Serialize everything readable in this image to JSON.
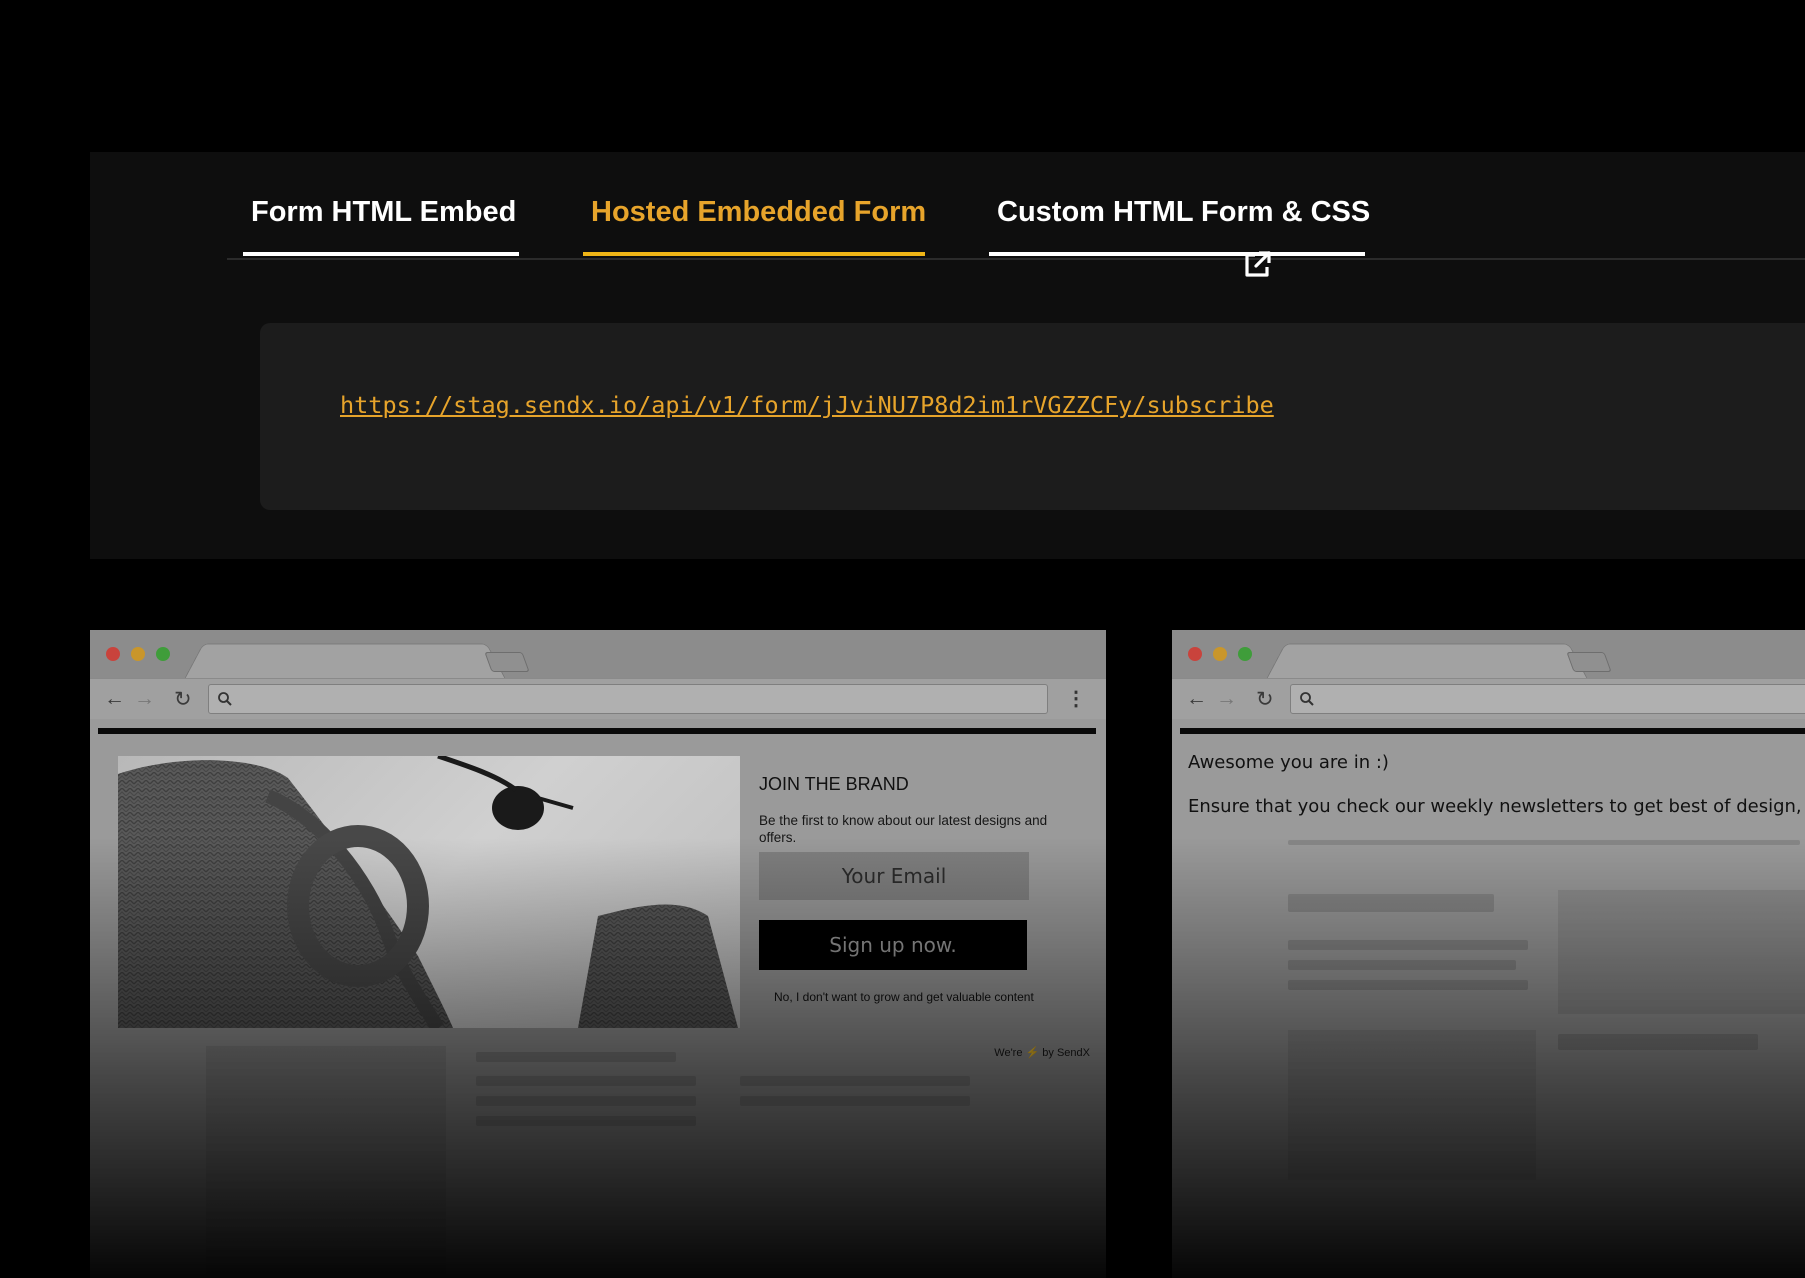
{
  "tabs": [
    {
      "label": "Form HTML Embed",
      "active": false
    },
    {
      "label": "Hosted Embedded Form",
      "active": true
    },
    {
      "label": "Custom HTML Form & CSS",
      "active": false
    }
  ],
  "hosted_url": "https://stag.sendx.io/api/v1/form/jJviNU7P8d2im1rVGZZCFy/subscribe",
  "colors": {
    "accent": "#f0b517",
    "accent_text": "#e7a42b",
    "panel": "#0e0e0e",
    "url_box": "#1c1c1c"
  },
  "icons": {
    "external_link": "external-link-icon",
    "search": "search-icon",
    "back": "back-arrow-icon",
    "forward": "forward-arrow-icon",
    "reload": "reload-icon",
    "menu": "kebab-menu-icon"
  },
  "form_preview": {
    "title": "JOIN THE BRAND",
    "description": "Be the first to know about our latest designs and offers.",
    "email_placeholder": "Your Email",
    "submit_label": "Sign up now.",
    "decline_link": "No, I don't want to grow and get valuable content",
    "powered_prefix": "We're",
    "powered_suffix": "by SendX"
  },
  "thank_you_preview": {
    "heading": "Awesome you are in :)",
    "message": "Ensure that you check our weekly newsletters to get best of design, fashio"
  }
}
